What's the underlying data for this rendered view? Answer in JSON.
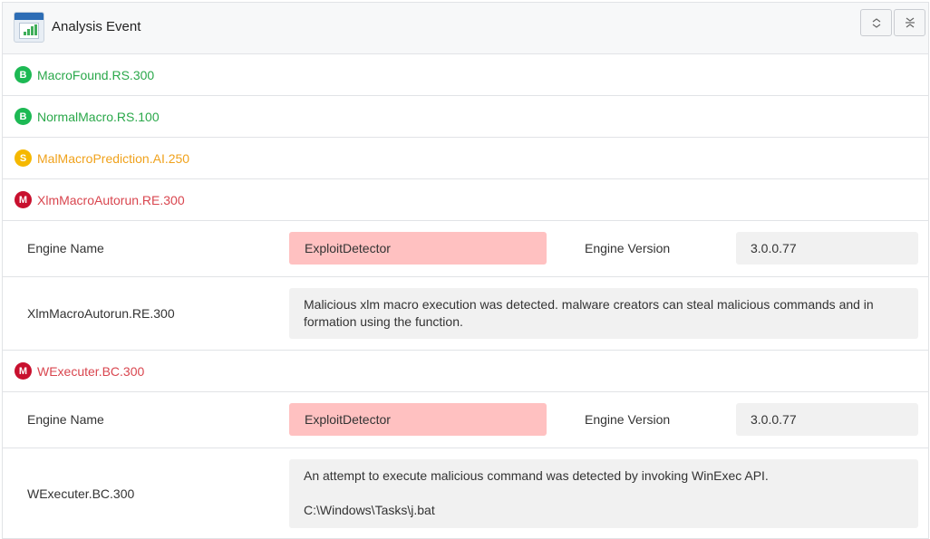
{
  "header": {
    "title": "Analysis Event",
    "icon": "analysis-chart-icon"
  },
  "header_buttons": {
    "expand_icon": "expand-all-icon",
    "collapse_icon": "collapse-all-icon"
  },
  "colors": {
    "benign": "#1db954",
    "suspicious": "#f5b800",
    "malicious": "#c8102e",
    "benign_text": "#2aa84a",
    "suspicious_text": "#f0a21c",
    "malicious_text": "#d9464f"
  },
  "rules": [
    {
      "badge": "B",
      "name": "MacroFound.RS.300"
    },
    {
      "badge": "B",
      "name": "NormalMacro.RS.100"
    },
    {
      "badge": "S",
      "name": "MalMacroPrediction.AI.250"
    },
    {
      "badge": "M",
      "name": "XlmMacroAutorun.RE.300",
      "details": {
        "engine_name_label": "Engine Name",
        "engine_name": "ExploitDetector",
        "engine_version_label": "Engine Version",
        "engine_version": "3.0.0.77",
        "rule_label": "XlmMacroAutorun.RE.300",
        "description": "Malicious xlm macro execution was detected. malware creators can steal malicious commands and in formation using the function."
      }
    },
    {
      "badge": "M",
      "name": "WExecuter.BC.300",
      "details": {
        "engine_name_label": "Engine Name",
        "engine_name": "ExploitDetector",
        "engine_version_label": "Engine Version",
        "engine_version": "3.0.0.77",
        "rule_label": "WExecuter.BC.300",
        "description": "An attempt to execute malicious command was detected by invoking WinExec API.",
        "path": "C:\\Windows\\Tasks\\j.bat"
      }
    }
  ]
}
